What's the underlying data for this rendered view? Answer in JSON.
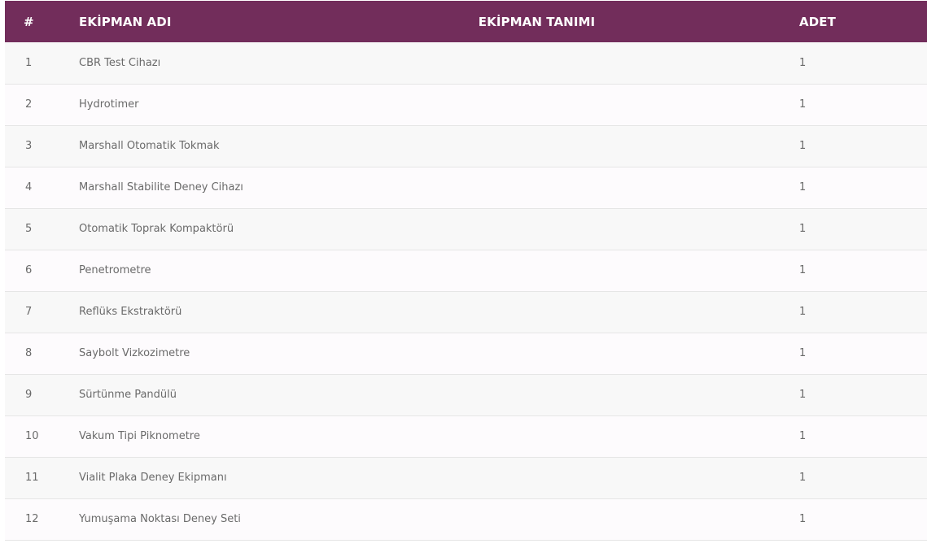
{
  "table": {
    "headers": {
      "num": "#",
      "name": "EKİPMAN ADI",
      "description": "EKİPMAN TANIMI",
      "quantity": "ADET"
    },
    "rows": [
      {
        "num": "1",
        "name": "CBR Test Cihazı",
        "description": "",
        "quantity": "1"
      },
      {
        "num": "2",
        "name": "Hydrotimer",
        "description": "",
        "quantity": "1"
      },
      {
        "num": "3",
        "name": "Marshall Otomatik Tokmak",
        "description": "",
        "quantity": "1"
      },
      {
        "num": "4",
        "name": "Marshall Stabilite Deney Cihazı",
        "description": "",
        "quantity": "1"
      },
      {
        "num": "5",
        "name": "Otomatik Toprak Kompaktörü",
        "description": "",
        "quantity": "1"
      },
      {
        "num": "6",
        "name": "Penetrometre",
        "description": "",
        "quantity": "1"
      },
      {
        "num": "7",
        "name": "Reflüks Ekstraktörü",
        "description": "",
        "quantity": "1"
      },
      {
        "num": "8",
        "name": "Saybolt Vizkozimetre",
        "description": "",
        "quantity": "1"
      },
      {
        "num": "9",
        "name": "Sürtünme Pandülü",
        "description": "",
        "quantity": "1"
      },
      {
        "num": "10",
        "name": "Vakum Tipi Piknometre",
        "description": "",
        "quantity": "1"
      },
      {
        "num": "11",
        "name": "Vialit Plaka Deney Ekipmanı",
        "description": "",
        "quantity": "1"
      },
      {
        "num": "12",
        "name": "Yumuşama Noktası Deney Seti",
        "description": "",
        "quantity": "1"
      }
    ]
  },
  "colors": {
    "header_bg": "#722d5b",
    "header_text": "#ffffff",
    "cell_text": "#6a6a6a"
  }
}
